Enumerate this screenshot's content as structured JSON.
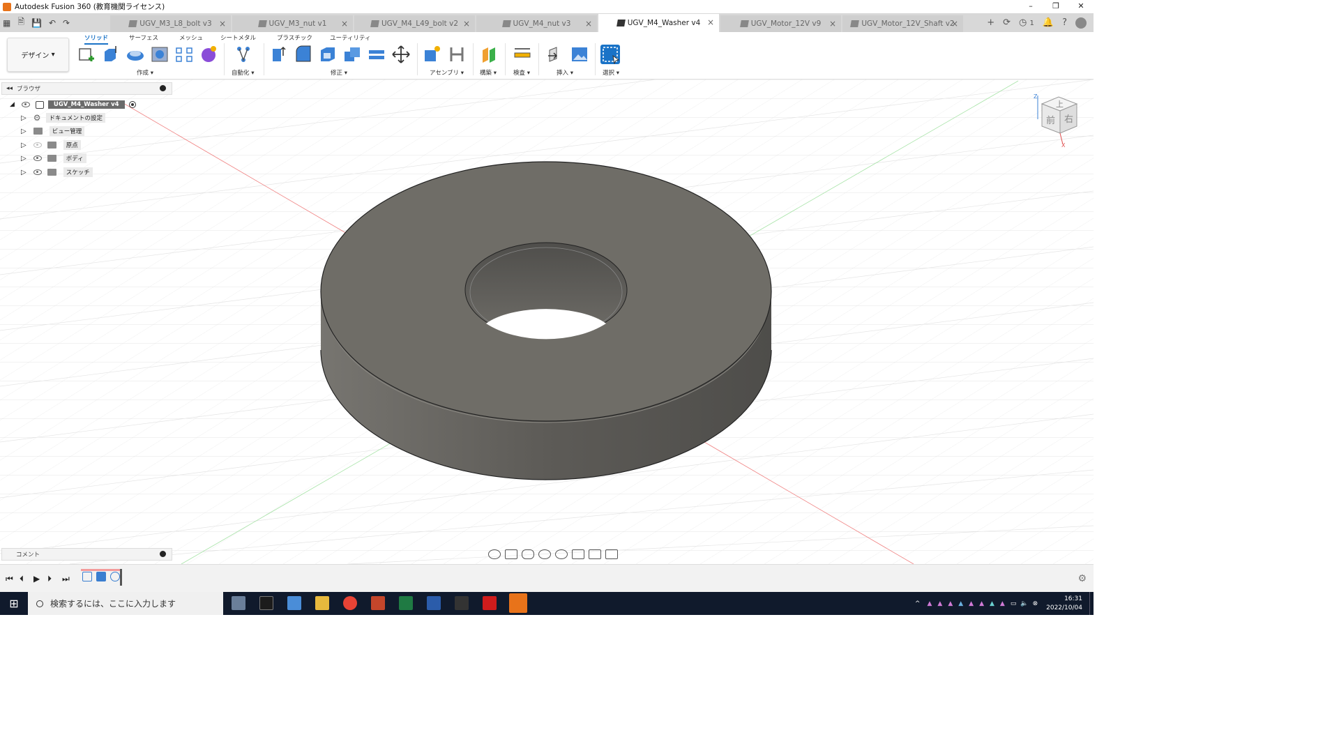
{
  "window": {
    "title": "Autodesk Fusion 360 (教育機関ライセンス)"
  },
  "tabs": [
    {
      "label": "UGV_M3_L8_bolt v3",
      "active": false
    },
    {
      "label": "UGV_M3_nut v1",
      "active": false
    },
    {
      "label": "UGV_M4_L49_bolt v2",
      "active": false
    },
    {
      "label": "UGV_M4_nut v3",
      "active": false
    },
    {
      "label": "UGV_M4_Washer v4",
      "active": true
    },
    {
      "label": "UGV_Motor_12V v9",
      "active": false
    },
    {
      "label": "UGV_Motor_12V_Shaft v2",
      "active": false
    }
  ],
  "tabbar_right": {
    "notification_count": "1"
  },
  "toolbar": {
    "workspace_label": "デザイン",
    "ribbon_tabs": [
      "ソリッド",
      "サーフェス",
      "メッシュ",
      "シートメタル",
      "プラスチック",
      "ユーティリティ"
    ],
    "groups": [
      "作成",
      "自動化",
      "修正",
      "アセンブリ",
      "構築",
      "検査",
      "挿入",
      "選択"
    ]
  },
  "browser": {
    "title": "ブラウザ",
    "root": "UGV_M4_Washer v4",
    "items": [
      "ドキュメントの設定",
      "ビュー管理",
      "原点",
      "ボディ",
      "スケッチ"
    ]
  },
  "comments": {
    "label": "コメント"
  },
  "viewcube": {
    "top": "上",
    "front": "前",
    "right": "右",
    "axis_z": "Z",
    "axis_x": "X"
  },
  "taskbar": {
    "search_placeholder": "検索するには、ここに入力します",
    "time": "16:31",
    "date": "2022/10/04"
  },
  "colors": {
    "accent": "#1a73c7",
    "body": "#6e6c66",
    "taskbar": "#101a2c"
  }
}
